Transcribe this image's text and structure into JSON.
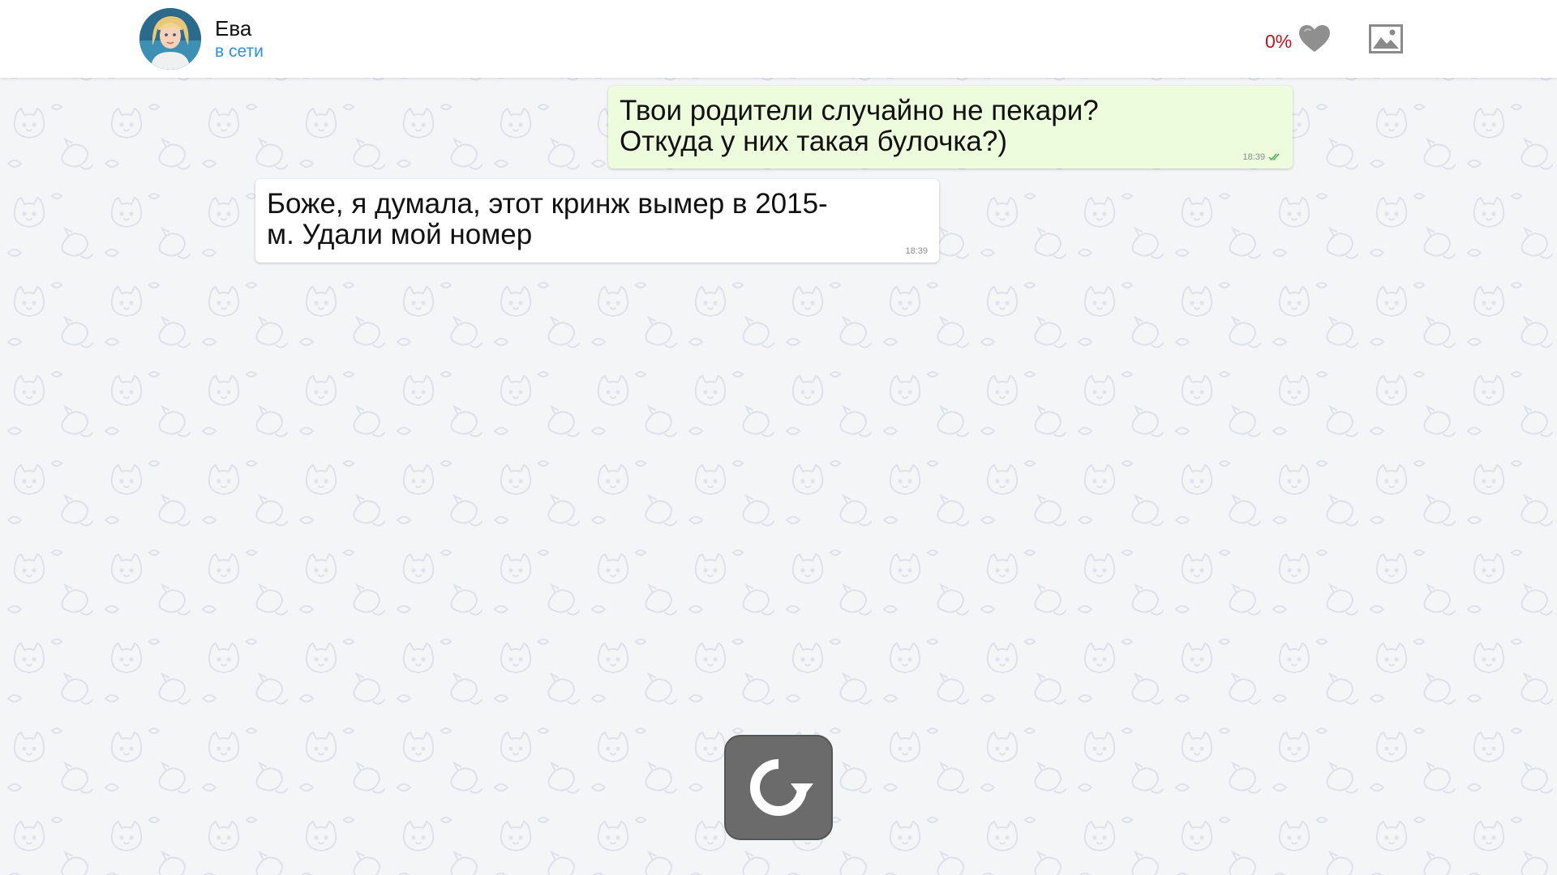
{
  "header": {
    "contact_name": "Ева",
    "contact_status": "в сети",
    "affection_value": "0%"
  },
  "messages": [
    {
      "direction": "outgoing",
      "text": "Твои родители случайно не пекари?\nОткуда у них такая булочка?)",
      "time": "18:39",
      "status": "read"
    },
    {
      "direction": "incoming",
      "text": "Боже, я думала, этот кринж вымер в 2015-\nм. Удали мой номер",
      "time": "18:39"
    }
  ],
  "icons": {
    "avatar": "avatar-photo",
    "affection": "heart-icon",
    "gallery": "image-icon",
    "read_receipt": "double-check-icon",
    "replay": "replay-icon"
  },
  "colors": {
    "status_text": "#2f8fd8",
    "affection_text": "#c0121c",
    "outgoing_bubble": "#eefcde",
    "incoming_bubble": "#ffffff",
    "replay_button": "#6b6b6b",
    "heart": "#8f8f8f"
  }
}
